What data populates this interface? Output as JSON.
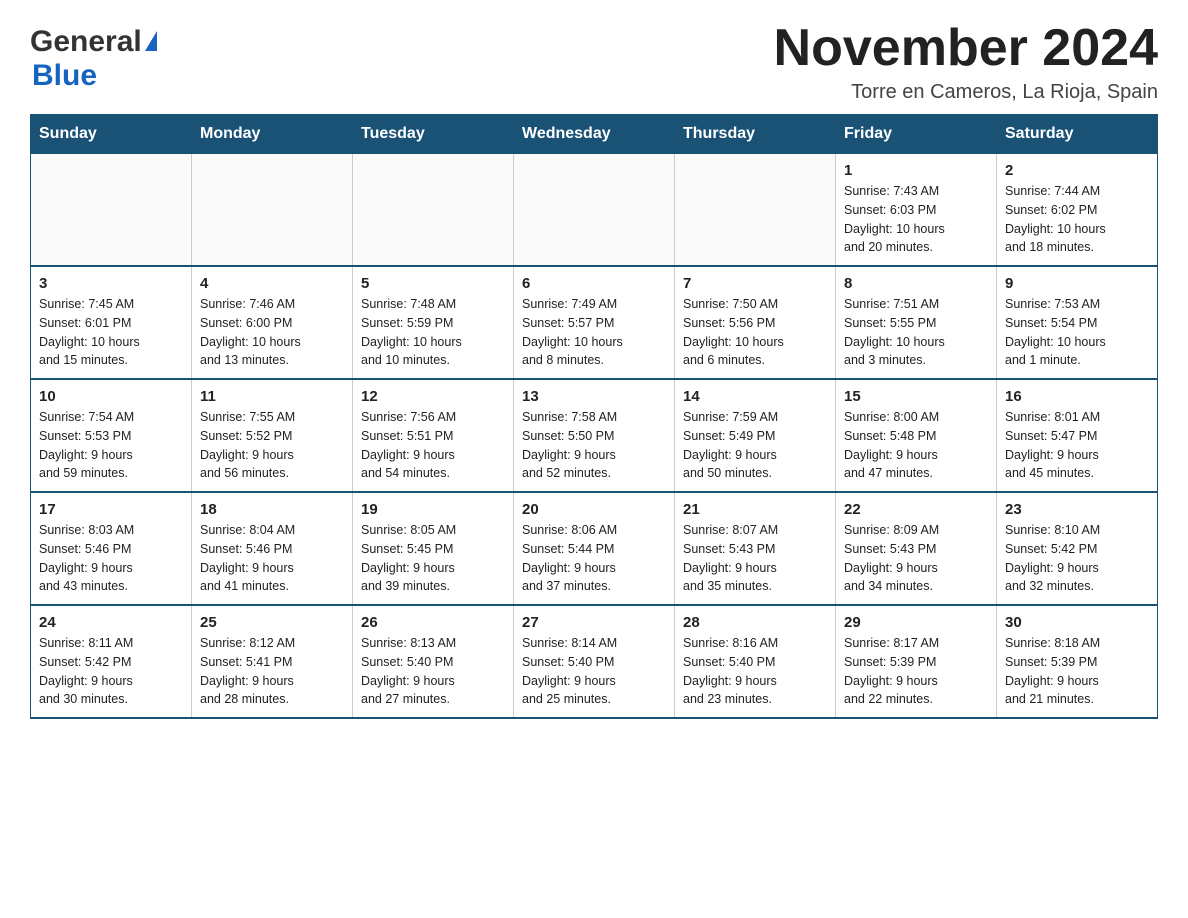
{
  "header": {
    "logo_general": "General",
    "logo_blue": "Blue",
    "title": "November 2024",
    "location": "Torre en Cameros, La Rioja, Spain"
  },
  "weekdays": [
    "Sunday",
    "Monday",
    "Tuesday",
    "Wednesday",
    "Thursday",
    "Friday",
    "Saturday"
  ],
  "weeks": [
    {
      "days": [
        {
          "number": "",
          "info": ""
        },
        {
          "number": "",
          "info": ""
        },
        {
          "number": "",
          "info": ""
        },
        {
          "number": "",
          "info": ""
        },
        {
          "number": "",
          "info": ""
        },
        {
          "number": "1",
          "info": "Sunrise: 7:43 AM\nSunset: 6:03 PM\nDaylight: 10 hours\nand 20 minutes."
        },
        {
          "number": "2",
          "info": "Sunrise: 7:44 AM\nSunset: 6:02 PM\nDaylight: 10 hours\nand 18 minutes."
        }
      ]
    },
    {
      "days": [
        {
          "number": "3",
          "info": "Sunrise: 7:45 AM\nSunset: 6:01 PM\nDaylight: 10 hours\nand 15 minutes."
        },
        {
          "number": "4",
          "info": "Sunrise: 7:46 AM\nSunset: 6:00 PM\nDaylight: 10 hours\nand 13 minutes."
        },
        {
          "number": "5",
          "info": "Sunrise: 7:48 AM\nSunset: 5:59 PM\nDaylight: 10 hours\nand 10 minutes."
        },
        {
          "number": "6",
          "info": "Sunrise: 7:49 AM\nSunset: 5:57 PM\nDaylight: 10 hours\nand 8 minutes."
        },
        {
          "number": "7",
          "info": "Sunrise: 7:50 AM\nSunset: 5:56 PM\nDaylight: 10 hours\nand 6 minutes."
        },
        {
          "number": "8",
          "info": "Sunrise: 7:51 AM\nSunset: 5:55 PM\nDaylight: 10 hours\nand 3 minutes."
        },
        {
          "number": "9",
          "info": "Sunrise: 7:53 AM\nSunset: 5:54 PM\nDaylight: 10 hours\nand 1 minute."
        }
      ]
    },
    {
      "days": [
        {
          "number": "10",
          "info": "Sunrise: 7:54 AM\nSunset: 5:53 PM\nDaylight: 9 hours\nand 59 minutes."
        },
        {
          "number": "11",
          "info": "Sunrise: 7:55 AM\nSunset: 5:52 PM\nDaylight: 9 hours\nand 56 minutes."
        },
        {
          "number": "12",
          "info": "Sunrise: 7:56 AM\nSunset: 5:51 PM\nDaylight: 9 hours\nand 54 minutes."
        },
        {
          "number": "13",
          "info": "Sunrise: 7:58 AM\nSunset: 5:50 PM\nDaylight: 9 hours\nand 52 minutes."
        },
        {
          "number": "14",
          "info": "Sunrise: 7:59 AM\nSunset: 5:49 PM\nDaylight: 9 hours\nand 50 minutes."
        },
        {
          "number": "15",
          "info": "Sunrise: 8:00 AM\nSunset: 5:48 PM\nDaylight: 9 hours\nand 47 minutes."
        },
        {
          "number": "16",
          "info": "Sunrise: 8:01 AM\nSunset: 5:47 PM\nDaylight: 9 hours\nand 45 minutes."
        }
      ]
    },
    {
      "days": [
        {
          "number": "17",
          "info": "Sunrise: 8:03 AM\nSunset: 5:46 PM\nDaylight: 9 hours\nand 43 minutes."
        },
        {
          "number": "18",
          "info": "Sunrise: 8:04 AM\nSunset: 5:46 PM\nDaylight: 9 hours\nand 41 minutes."
        },
        {
          "number": "19",
          "info": "Sunrise: 8:05 AM\nSunset: 5:45 PM\nDaylight: 9 hours\nand 39 minutes."
        },
        {
          "number": "20",
          "info": "Sunrise: 8:06 AM\nSunset: 5:44 PM\nDaylight: 9 hours\nand 37 minutes."
        },
        {
          "number": "21",
          "info": "Sunrise: 8:07 AM\nSunset: 5:43 PM\nDaylight: 9 hours\nand 35 minutes."
        },
        {
          "number": "22",
          "info": "Sunrise: 8:09 AM\nSunset: 5:43 PM\nDaylight: 9 hours\nand 34 minutes."
        },
        {
          "number": "23",
          "info": "Sunrise: 8:10 AM\nSunset: 5:42 PM\nDaylight: 9 hours\nand 32 minutes."
        }
      ]
    },
    {
      "days": [
        {
          "number": "24",
          "info": "Sunrise: 8:11 AM\nSunset: 5:42 PM\nDaylight: 9 hours\nand 30 minutes."
        },
        {
          "number": "25",
          "info": "Sunrise: 8:12 AM\nSunset: 5:41 PM\nDaylight: 9 hours\nand 28 minutes."
        },
        {
          "number": "26",
          "info": "Sunrise: 8:13 AM\nSunset: 5:40 PM\nDaylight: 9 hours\nand 27 minutes."
        },
        {
          "number": "27",
          "info": "Sunrise: 8:14 AM\nSunset: 5:40 PM\nDaylight: 9 hours\nand 25 minutes."
        },
        {
          "number": "28",
          "info": "Sunrise: 8:16 AM\nSunset: 5:40 PM\nDaylight: 9 hours\nand 23 minutes."
        },
        {
          "number": "29",
          "info": "Sunrise: 8:17 AM\nSunset: 5:39 PM\nDaylight: 9 hours\nand 22 minutes."
        },
        {
          "number": "30",
          "info": "Sunrise: 8:18 AM\nSunset: 5:39 PM\nDaylight: 9 hours\nand 21 minutes."
        }
      ]
    }
  ]
}
